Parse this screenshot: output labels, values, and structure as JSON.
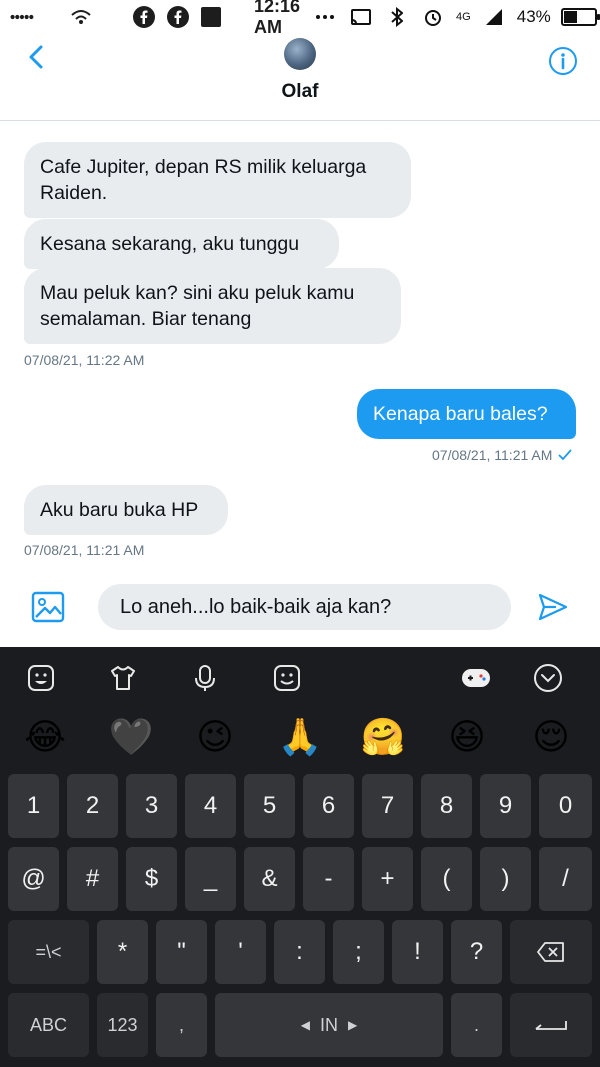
{
  "status_bar": {
    "time": "12:16 AM",
    "battery": "43%",
    "network": "4G",
    "battery_level": 0.43
  },
  "header": {
    "contact_name": "Olaf",
    "back_icon": "chevron-left-icon",
    "info_icon": "info-icon"
  },
  "messages": [
    {
      "direction": "received",
      "text_lines": [
        "Cafe Jupiter, depan RS milik keluarga",
        "Raiden."
      ]
    },
    {
      "direction": "received",
      "text_lines": [
        "Kesana sekarang, aku tunggu"
      ]
    },
    {
      "direction": "received",
      "text_lines": [
        "Mau peluk kan? sini aku peluk kamu",
        "semalaman. Biar tenang"
      ]
    },
    {
      "direction": "received_timestamp",
      "text": "07/08/21, 11:22 AM"
    },
    {
      "direction": "sent",
      "text_lines": [
        "Kenapa baru bales?"
      ]
    },
    {
      "direction": "sent_timestamp",
      "text": "07/08/21, 11:21 AM",
      "read": true
    },
    {
      "direction": "received",
      "text_lines": [
        "Aku baru buka HP"
      ]
    },
    {
      "direction": "received_timestamp",
      "text": "07/08/21, 11:21 AM"
    }
  ],
  "compose": {
    "draft": "Lo aneh...lo baik-baik aja kan?",
    "media_icon": "image-icon",
    "send_icon": "send-icon"
  },
  "keyboard": {
    "toolbar": [
      "sticker-icon",
      "shirt-icon",
      "mic-icon",
      "emoji-icon",
      "gamepad-icon",
      "chevron-down-icon"
    ],
    "emoji_suggestions": [
      "😂",
      "🖤",
      "😉",
      "🙏",
      "🤗",
      "😆",
      "😌"
    ],
    "row_numbers": [
      "1",
      "2",
      "3",
      "4",
      "5",
      "6",
      "7",
      "8",
      "9",
      "0"
    ],
    "row_symbols": [
      "@",
      "#",
      "$",
      "_",
      "&",
      "-",
      "+",
      "(",
      ")",
      "/"
    ],
    "row_punct": [
      "=\\<",
      "*",
      "\"",
      "'",
      ":",
      ";",
      "!",
      "?"
    ],
    "bottom": {
      "abc": "ABC",
      "num": "123",
      "comma": ",",
      "space": "IN",
      "period": "."
    }
  },
  "colors": {
    "accent": "#1d9bf0",
    "received_bubble": "#e8ecef",
    "keyboard_bg": "#1b1c1f",
    "key_bg": "#35363a"
  }
}
